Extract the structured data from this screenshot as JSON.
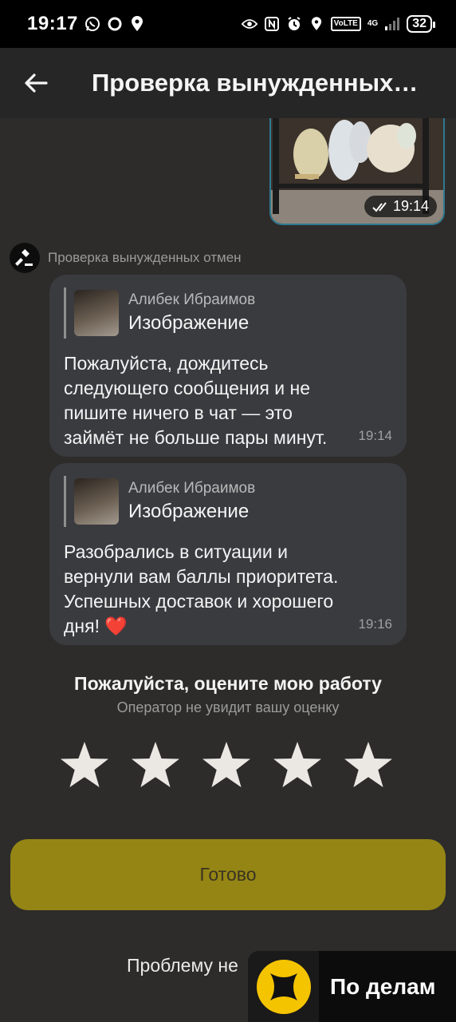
{
  "status_bar": {
    "time": "19:17",
    "volte": "VoLTE",
    "network": "4G",
    "battery": "32"
  },
  "header": {
    "title": "Проверка вынужденных…"
  },
  "photo_message": {
    "time": "19:14"
  },
  "sender": {
    "name": "Проверка вынужденных отмен"
  },
  "messages": [
    {
      "quote_author": "Алибек Ибраимов",
      "quote_text": "Изображение",
      "text": "Пожалуйста, дождитесь следующего сообщения и не пишите ничего в чат — это займёт не больше пары минут.",
      "time": "19:14"
    },
    {
      "quote_author": "Алибек Ибраимов",
      "quote_text": "Изображение",
      "text": "Разобрались в ситуации и вернули вам баллы приоритета. Успешных доставок и хорошего дня!",
      "emoji": "❤️",
      "time": "19:16"
    }
  ],
  "rating": {
    "title": "Пожалуйста, оцените мою работу",
    "subtitle": "Оператор не увидит вашу оценку",
    "stars": 5
  },
  "done_button": "Готово",
  "problem_link": "Проблему не",
  "promo": {
    "label": "По делам",
    "accent": "#f5c400"
  },
  "colors": {
    "background": "#2d2c2b",
    "bubble": "#3a3b3f",
    "done_button": "#958514",
    "photo_border": "#2e7a92",
    "heart": "#e0262e"
  }
}
